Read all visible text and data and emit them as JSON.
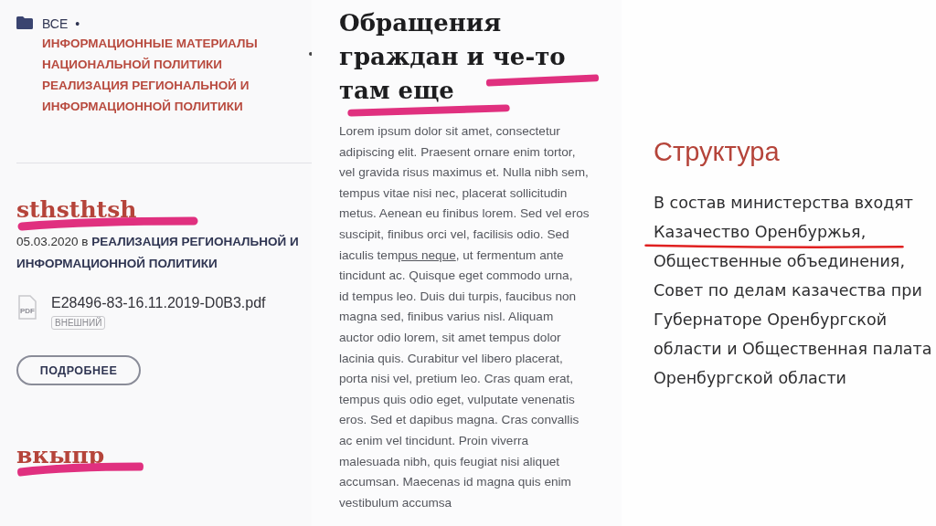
{
  "left": {
    "breadcrumb": {
      "root": "ВСЕ",
      "separator": "•",
      "categories": [
        "ИНФОРМАЦИОННЫЕ МАТЕРИАЛЫ НАЦИОНАЛЬНОЙ ПОЛИТИКИ",
        "РЕАЛИЗАЦИЯ РЕГИОНАЛЬНОЙ И ИНФОРМАЦИОННОЙ ПОЛИТИКИ"
      ]
    },
    "posts": [
      {
        "title": "sthsthtsh",
        "date": "05.03.2020",
        "preposition": "в",
        "category": "РЕАЛИЗАЦИЯ РЕГИОНАЛЬНОЙ И ИНФОРМАЦИОННОЙ ПОЛИТИКИ",
        "file": {
          "icon_text": "PDF",
          "name": "E28496-83-16.11.2019-D0B3.pdf",
          "badge": "ВНЕШНИЙ"
        },
        "button": "ПОДРОБНЕЕ"
      },
      {
        "title": "вкыпр"
      }
    ]
  },
  "middle": {
    "heading_lines": [
      "Обращения",
      "граждан и че-то",
      "там еще"
    ],
    "lines": [
      {
        "text": "Lorem ipsum dolor sit amet, consectetur"
      },
      {
        "text": "adipiscing elit. Praesent ornare enim tortor,"
      },
      {
        "text": "vel gravida risus maximus et. Nulla nibh sem,"
      },
      {
        "text": "tempus vitae nisi nec, placerat sollicitudin"
      },
      {
        "text": "metus. Aenean eu finibus lorem. Sed vel eros"
      },
      {
        "text": "suscipit, finibus orci vel, facilisis odio. Sed"
      },
      {
        "text": "iaculis tem",
        "link": "pus neque",
        "tail": ", ut fermentum ante"
      },
      {
        "text": "tincidunt ac. Quisque eget commodo urna,"
      },
      {
        "text": "id tempus leo. Duis dui turpis, faucibus non"
      },
      {
        "text": "magna sed, finibus varius nisl. Aliquam"
      },
      {
        "text": "auctor odio lorem, sit amet tempus dolor"
      },
      {
        "text": "lacinia quis. Curabitur vel libero placerat,"
      },
      {
        "text": "porta nisi vel, pretium leo. Cras quam erat,"
      },
      {
        "text": "tempus quis odio eget, vulputate venenatis"
      },
      {
        "text": "eros. Sed et dapibus magna. Cras convallis"
      },
      {
        "text": "ac enim vel tincidunt. Proin viverra"
      },
      {
        "text": "malesuada nibh, quis feugiat nisi aliquet"
      },
      {
        "text": "accumsan. Maecenas id magna quis enim"
      },
      {
        "text": "vestibulum accumsa"
      }
    ]
  },
  "right": {
    "heading": "Структура",
    "lines": [
      "В состав министерства входят",
      "Казачество Оренбуржья,",
      "Общественные объединения,",
      "Совет по делам казачества при",
      "Губернаторе Оренбургской",
      "области и Общественная палата",
      "Оренбургской области"
    ]
  }
}
